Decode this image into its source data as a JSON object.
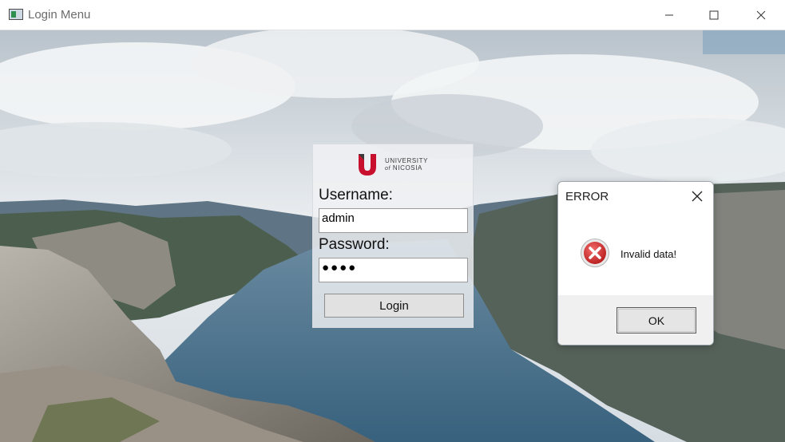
{
  "window": {
    "title": "Login Menu",
    "icon": "app-window-icon",
    "controls": [
      "minimize-icon",
      "maximize-icon",
      "close-icon"
    ]
  },
  "login": {
    "logo": {
      "line1": "UNIVERSITY",
      "line2_prefix": "of",
      "line2": "NICOSIA",
      "brand_color": "#c8102e"
    },
    "username_label": "Username:",
    "username_value": "admin",
    "password_label": "Password:",
    "password_value": "●●●●",
    "login_button": "Login"
  },
  "dialog": {
    "title": "ERROR",
    "message": "Invalid data!",
    "icon": "error-icon",
    "ok_button": "OK",
    "error_color": "#d32f2f"
  }
}
